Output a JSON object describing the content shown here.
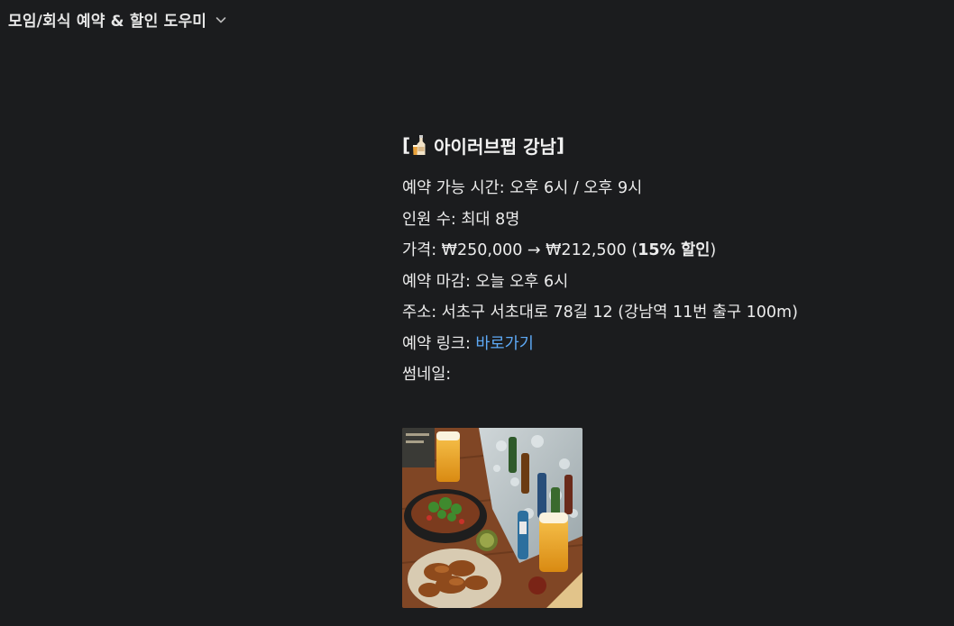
{
  "header": {
    "title": "모임/회식 예약 & 할인 도우미",
    "dropdown_icon": "chevron-down-icon"
  },
  "listing": {
    "bracket_open": "[",
    "emoji_icon": "beer-bottle-glass-icon",
    "name": "아이러브펍 강남",
    "bracket_close": "]",
    "time_label": "예약 가능 시간: ",
    "time_value": "오후 6시 / 오후 9시",
    "people_label": "인원 수: ",
    "people_value": "최대 8명",
    "price_label": "가격: ",
    "price_value": "₩250,000 → ₩212,500 (",
    "discount": "15% 할인",
    "price_close": ")",
    "deadline_label": "예약 마감: ",
    "deadline_value": "오늘 오후 6시",
    "address_label": "주소: ",
    "address_value": "서초구 서초대로 78길 12 (강남역 11번 출구 100m)",
    "link_label": "예약 링크: ",
    "link_text": "바로가기",
    "thumbnail_label": "썸네일:"
  },
  "colors": {
    "background": "#1b1c1e",
    "text": "#ececec",
    "link": "#5eaaf7"
  }
}
